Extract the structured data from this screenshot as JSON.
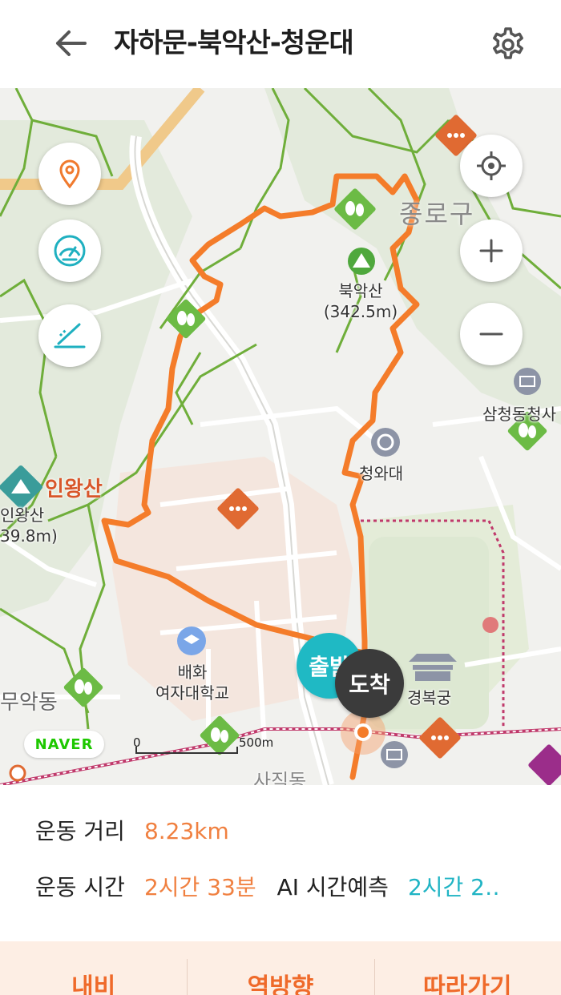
{
  "header": {
    "title": "자하문-북악산-청운대",
    "back_icon": "arrow-left-icon",
    "settings_icon": "gear-icon"
  },
  "map": {
    "left_controls": [
      {
        "icon": "map-pin-icon"
      },
      {
        "icon": "speedometer-icon"
      },
      {
        "icon": "elevation-icon"
      }
    ],
    "right_controls": [
      {
        "icon": "current-location-icon"
      },
      {
        "icon": "zoom-in-icon"
      },
      {
        "icon": "zoom-out-icon"
      }
    ],
    "labels": {
      "district": "종로구",
      "bukaksan_name": "북악산",
      "bukaksan_height": "(342.5m)",
      "cheongwadae": "청와대",
      "samcheong": "삼청동청사",
      "inwangsan_title": "인왕산",
      "inwangsan_name": "인왕산",
      "inwangsan_height": "39.8m)",
      "baehwa_line1": "배화",
      "baehwa_line2": "여자대학교",
      "gyeongbokgung": "경복궁",
      "muak": "무악동",
      "sajik": "사직동"
    },
    "naver_logo": "NAVER",
    "scale": {
      "start": "0",
      "end": "500m"
    },
    "start_pin": "출발",
    "end_pin": "도착",
    "colors": {
      "route": "#f47c2a",
      "mountain_trail": "#6fae3a",
      "forest_marker": "#6cbb45",
      "poi_marker": "#e06a32",
      "start_pin": "#1fb9c4",
      "end_pin": "#3b3b3b",
      "subway_line": "#c0396b"
    }
  },
  "info": {
    "distance_label": "운동 거리",
    "distance_value": "8.23km",
    "time_label": "운동 시간",
    "time_value": "2시간 33분",
    "ai_label": "AI 시간예측",
    "ai_value": "2시간 2‥"
  },
  "bottom": {
    "nav": "내비",
    "reverse": "역방향",
    "follow": "따라가기"
  }
}
